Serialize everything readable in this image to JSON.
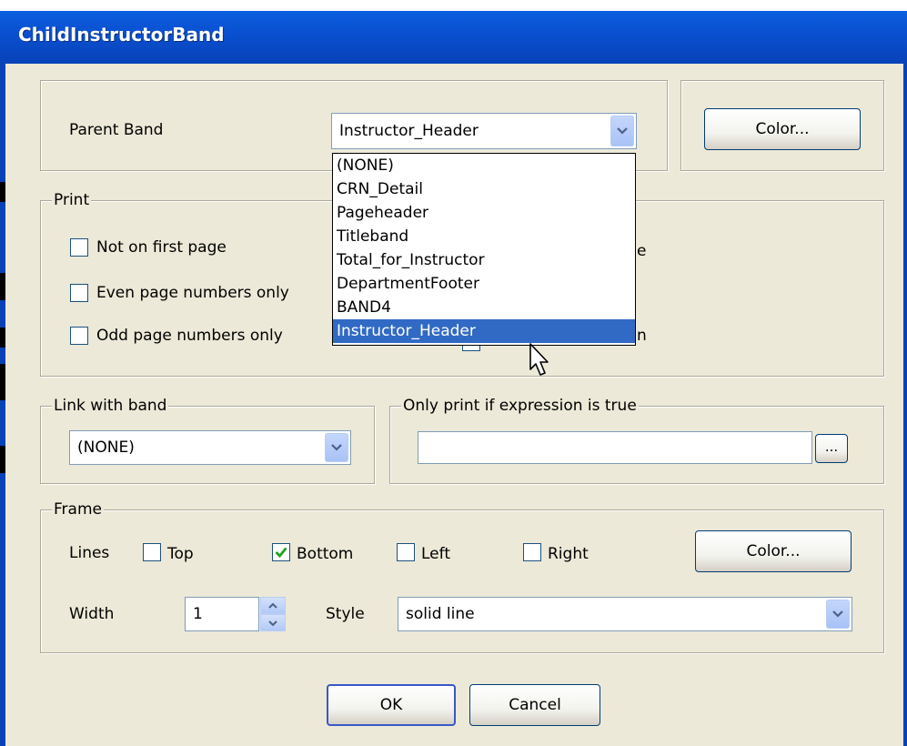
{
  "window": {
    "title": "ChildInstructorBand"
  },
  "parent_band": {
    "label": "Parent Band",
    "value": "Instructor_Header",
    "options": [
      "(NONE)",
      "CRN_Detail",
      "Pageheader",
      "Titleband",
      "Total_for_Instructor",
      "DepartmentFooter",
      "BAND4",
      "Instructor_Header"
    ],
    "selected_index": 7
  },
  "band_color_button": "Color...",
  "print": {
    "legend": "Print",
    "not_first_page": "Not on first page",
    "even_pages": "Even page numbers only",
    "odd_pages": "Odd page numbers only",
    "right_partial_1": "e",
    "right_partial_2": "n"
  },
  "link": {
    "legend": "Link with band",
    "value": "(NONE)"
  },
  "expression": {
    "legend": "Only print if expression is true",
    "value": "",
    "browse_label": "..."
  },
  "frame": {
    "legend": "Frame",
    "lines_label": "Lines",
    "top": "Top",
    "bottom": "Bottom",
    "left": "Left",
    "right": "Right",
    "top_checked": false,
    "bottom_checked": true,
    "left_checked": false,
    "right_checked": false,
    "color_button": "Color...",
    "width_label": "Width",
    "width_value": "1",
    "style_label": "Style",
    "style_value": "solid line"
  },
  "buttons": {
    "ok": "OK",
    "cancel": "Cancel"
  }
}
